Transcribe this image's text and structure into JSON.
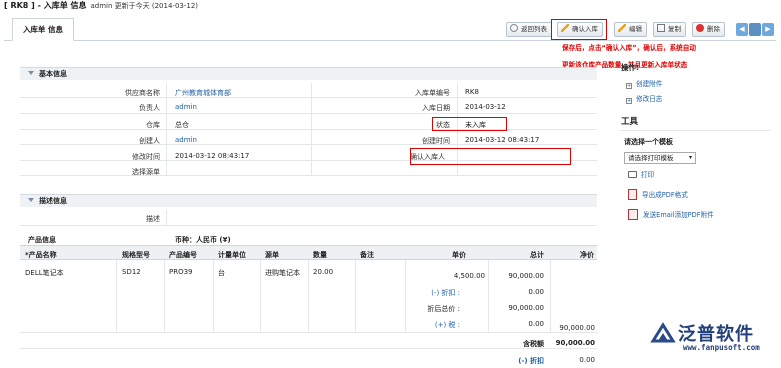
{
  "header": {
    "title": "[ RK8 ] - 入库单 信息",
    "subtitle": "admin 更新于今天 (2014-03-12)"
  },
  "tab": {
    "label": "入库单 信息"
  },
  "toolbar": {
    "back": "返回列表",
    "confirm": "确认入库",
    "edit": "编辑",
    "copy": "复制",
    "delete": "删除"
  },
  "annotation": {
    "line1": "保存后，点击“确认入库”，确认后，系统自动",
    "line2": "更新该仓库产品数量，并且更新入库单状态"
  },
  "basic": {
    "section": "基本信息",
    "supplier_label": "供应商名称",
    "supplier": "广州教育城体育部",
    "owner_label": "负责人",
    "owner": "admin",
    "warehouse_label": "仓库",
    "warehouse": "总仓",
    "creator_label": "创建人",
    "creator": "admin",
    "modified_label": "修改时间",
    "modified": "2014-03-12 08:43:17",
    "source_label": "选择源单",
    "source": "",
    "number_label": "入库单编号",
    "number": "RK8",
    "date_label": "入库日期",
    "date": "2014-03-12",
    "status_label": "状态",
    "status": "未入库",
    "created_label": "创建时间",
    "created": "2014-03-12 08:43:17",
    "confirmer_label": "确认入库人",
    "confirmer": ""
  },
  "desc": {
    "section": "描述信息",
    "desc_label": "描述",
    "desc": ""
  },
  "products": {
    "title": "产品信息",
    "currency": "币种：人民币 (¥)",
    "headers": {
      "name": "*产品名称",
      "model": "规格型号",
      "code": "产品编号",
      "unit": "计量单位",
      "source": "源单",
      "qty": "数量",
      "remark": "备注",
      "price": "单价",
      "total": "总计",
      "net": "净价"
    },
    "row": {
      "name": "DELL笔记本",
      "model": "SD12",
      "code": "PRO39",
      "unit": "台",
      "source": "进购笔记本",
      "qty": "20.00",
      "remark": "",
      "price": "4,500.00",
      "total": "90,000.00",
      "discount_label": "(-) 折扣 :",
      "discount": "0.00",
      "after_label": "折后总价 :",
      "after": "90,000.00",
      "tax_label": "(+) 税 :",
      "tax": "0.00",
      "net": "90,000.00"
    },
    "footer": {
      "tax_total_label": "含税额",
      "tax_total": "90,000.00",
      "discount_label": "(-) 折扣",
      "discount": "0.00"
    }
  },
  "sidebar": {
    "ops_title": "操作:",
    "create_attachment": "创建附件",
    "change_log": "修改日志",
    "tools_title": "工具",
    "template_title": "请选择一个模板",
    "template_select": "请选择打印模板",
    "print": "打印",
    "export_pdf": "导出成PDF格式",
    "email_pdf": "发送Email添加PDF附件"
  },
  "watermark": {
    "brand": "泛普软件",
    "url": "www.fanpusoft.com"
  }
}
